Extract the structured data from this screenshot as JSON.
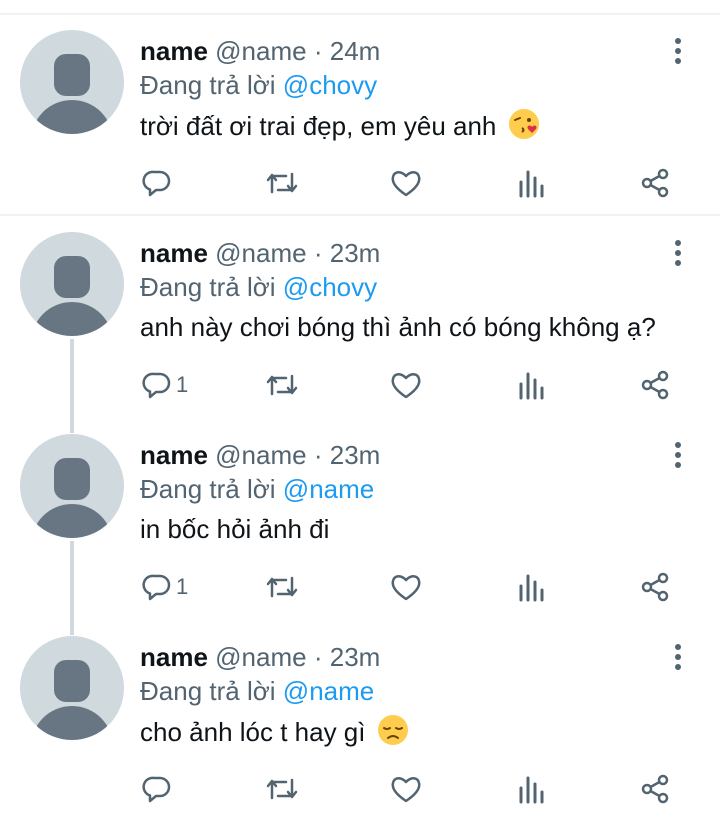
{
  "colors": {
    "accent": "#1d9bf0",
    "muted": "#536471",
    "text": "#0f1419",
    "avatar_bg": "#cfd9de",
    "avatar_fg": "#687684",
    "thread_line": "#cfd9de"
  },
  "reply_prefix": "Đang trả lời",
  "tweets": [
    {
      "name": "name",
      "handle": "@name",
      "separator": "·",
      "time": "24m",
      "reply_to": "@chovy",
      "text": "trời đất ơi trai đẹp, em yêu anh",
      "emoji": "face-blowing-kiss",
      "reply_count": ""
    },
    {
      "name": "name",
      "handle": "@name",
      "separator": "·",
      "time": "23m",
      "reply_to": "@chovy",
      "text": "anh này chơi bóng thì ảnh có bóng không ạ?",
      "emoji": "",
      "reply_count": "1"
    },
    {
      "name": "name",
      "handle": "@name",
      "separator": "·",
      "time": "23m",
      "reply_to": "@name",
      "text": "in bốc hỏi ảnh đi",
      "emoji": "",
      "reply_count": "1"
    },
    {
      "name": "name",
      "handle": "@name",
      "separator": "·",
      "time": "23m",
      "reply_to": "@name",
      "text": "cho ảnh lóc t hay gì",
      "emoji": "disappointed-face",
      "reply_count": ""
    }
  ]
}
